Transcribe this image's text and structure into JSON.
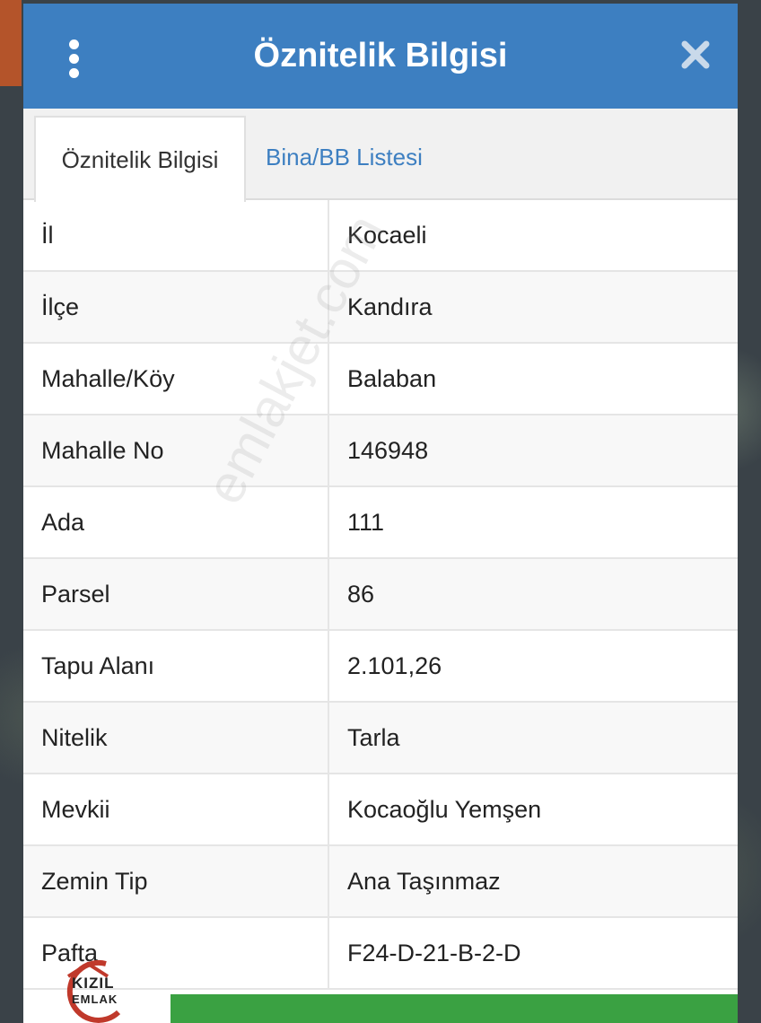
{
  "dialog": {
    "title": "Öznitelik Bilgisi",
    "header_color": "#3d7fc1",
    "icons": {
      "menu": "more-vertical-icon",
      "close": "close-icon"
    }
  },
  "tabs": [
    {
      "label": "Öznitelik Bilgisi",
      "active": true
    },
    {
      "label": "Bina/BB Listesi",
      "active": false
    }
  ],
  "attributes": [
    {
      "key": "İl",
      "value": "Kocaeli"
    },
    {
      "key": "İlçe",
      "value": "Kandıra"
    },
    {
      "key": "Mahalle/Köy",
      "value": "Balaban"
    },
    {
      "key": "Mahalle No",
      "value": "146948"
    },
    {
      "key": "Ada",
      "value": "111"
    },
    {
      "key": "Parsel",
      "value": "86"
    },
    {
      "key": "Tapu Alanı",
      "value": "2.101,26"
    },
    {
      "key": "Nitelik",
      "value": "Tarla"
    },
    {
      "key": "Mevkii",
      "value": "Kocaoğlu Yemşen"
    },
    {
      "key": "Zemin Tip",
      "value": "Ana Taşınmaz"
    },
    {
      "key": "Pafta",
      "value": "F24-D-21-B-2-D"
    }
  ],
  "watermark": "emlakjet.com",
  "logo": {
    "line1": "KIZIL",
    "line2": "EMLAK",
    "accent": "#c0392b"
  },
  "footer_button_color": "#3aa142"
}
